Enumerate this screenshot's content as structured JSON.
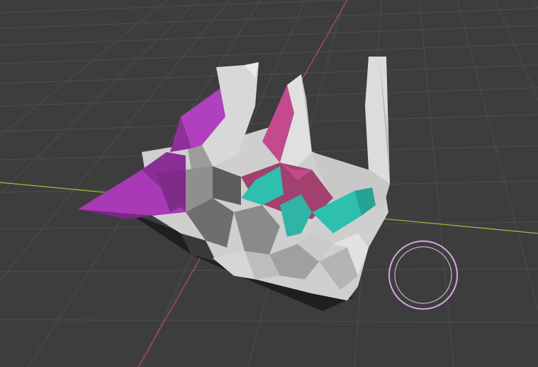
{
  "viewport": {
    "background": "#3d3d3d",
    "grid_color": "#4e4e4e",
    "x_axis_color": "#9bc43a",
    "y_axis_color": "#b8505a",
    "brush_cursor_color": "#d9a6e6"
  },
  "mesh": {
    "base_color": "#cfcfcf",
    "shade_color": "#7a7a7a",
    "paint_colors": [
      "#a83ab5",
      "#c44a8e",
      "#2fbfae"
    ]
  }
}
